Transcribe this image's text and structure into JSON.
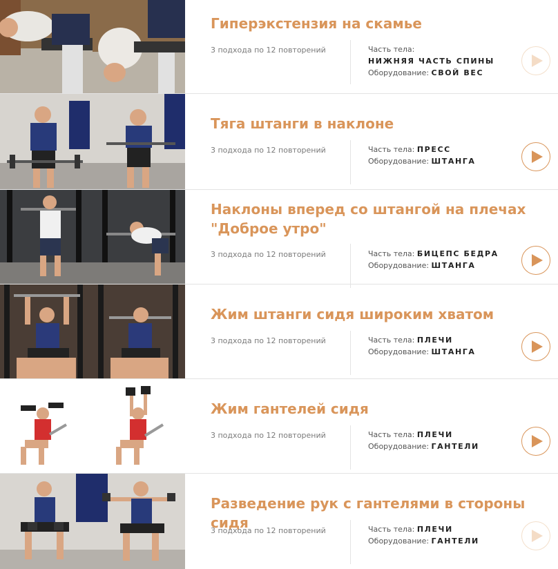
{
  "colors": {
    "accent": "#d9955a",
    "accent_faded": "#f4dcc6",
    "divider": "#e3e3e3"
  },
  "labels": {
    "body_part": "Часть тела:",
    "equipment": "Оборудование:"
  },
  "exercises": [
    {
      "title": "Гиперэкстензия на скамье",
      "sets": "3 подхода по 12 повторений",
      "body_part": "НИЖНЯЯ ЧАСТЬ СПИНЫ",
      "equipment": "СВОЙ ВЕС",
      "icon": "play-icon"
    },
    {
      "title": "Тяга штанги в наклоне",
      "sets": "3 подхода по 12 повторений",
      "body_part": "ПРЕСС",
      "equipment": "ШТАНГА",
      "icon": "play-icon"
    },
    {
      "title": "Наклоны вперед со штангой на плечах \"Доброе утро\"",
      "sets": "3 подхода по 12 повторений",
      "body_part": "БИЦЕПС БЕДРА",
      "equipment": "ШТАНГА",
      "icon": "play-icon"
    },
    {
      "title": "Жим штанги сидя широким хватом",
      "sets": "3 подхода по 12 повторений",
      "body_part": "ПЛЕЧИ",
      "equipment": "ШТАНГА",
      "icon": "play-icon"
    },
    {
      "title": "Жим гантелей сидя",
      "sets": "3 подхода по 12 повторений",
      "body_part": "ПЛЕЧИ",
      "equipment": "ГАНТЕЛИ",
      "icon": "play-icon"
    },
    {
      "title": "Разведение рук с гантелями в стороны сидя",
      "sets": "3 подхода по 12 повторений",
      "body_part": "ПЛЕЧИ",
      "equipment": "ГАНТЕЛИ",
      "icon": "play-icon"
    }
  ]
}
